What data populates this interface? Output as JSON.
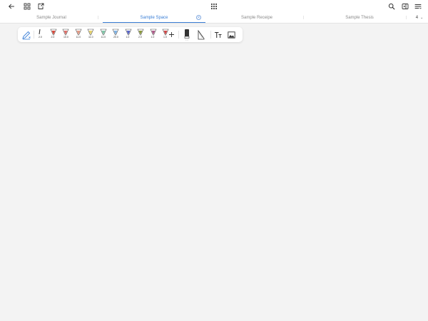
{
  "icons": {
    "back": "arrow-left-icon",
    "grid": "grid-icon",
    "share": "share-icon",
    "apps": "apps-icon",
    "search": "search-icon",
    "layout": "layout-icon",
    "menu": "menu-icon"
  },
  "tabs": [
    {
      "label": "Sample Journal",
      "active": false
    },
    {
      "label": "Sample Space",
      "active": true
    },
    {
      "label": "Sample Receipe",
      "active": false
    },
    {
      "label": "Sample Thesis",
      "active": false
    }
  ],
  "tab_counter": {
    "value": "4"
  },
  "pens": [
    {
      "size": "2.0",
      "color": "#222222"
    },
    {
      "size": "2.0",
      "color": "#d94b3d"
    },
    {
      "size": "10.0",
      "color": "#e0706a"
    },
    {
      "size": "11.0",
      "color": "#e39a86"
    },
    {
      "size": "11.0",
      "color": "#e6d26a"
    },
    {
      "size": "11.0",
      "color": "#7fc7a8"
    },
    {
      "size": "20.0",
      "color": "#7fb3e6"
    },
    {
      "size": "1.0",
      "color": "#5a66c9"
    },
    {
      "size": "2.0",
      "color": "#8b9a3c"
    },
    {
      "size": "1.0",
      "color": "#b05a8a"
    },
    {
      "size": "1.0",
      "color": "#d24a4a"
    }
  ],
  "colors": {
    "accent": "#3b7fd6",
    "background": "#f3f3f3"
  }
}
